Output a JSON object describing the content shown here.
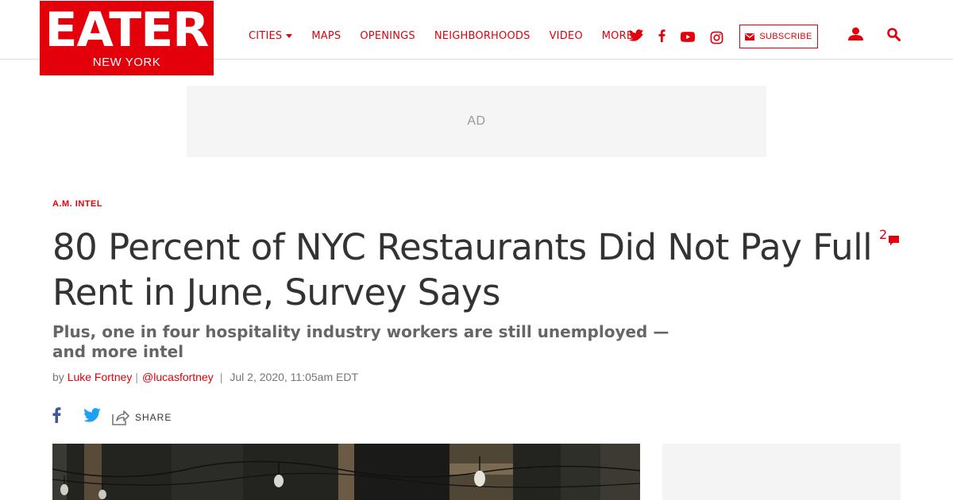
{
  "header": {
    "logo": {
      "main": "EATER",
      "sub": "NEW YORK"
    },
    "nav": [
      {
        "label": "CITIES",
        "dropdown": true
      },
      {
        "label": "MAPS",
        "dropdown": false
      },
      {
        "label": "OPENINGS",
        "dropdown": false
      },
      {
        "label": "NEIGHBORHOODS",
        "dropdown": false
      },
      {
        "label": "VIDEO",
        "dropdown": false
      },
      {
        "label": "MORE",
        "dropdown": true
      }
    ],
    "social_icons": [
      "twitter-icon",
      "facebook-icon",
      "youtube-icon",
      "instagram-icon"
    ],
    "subscribe_label": "SUBSCRIBE",
    "user_icon": "user-icon",
    "search_icon": "search-icon"
  },
  "ad": {
    "label": "AD"
  },
  "article": {
    "kicker": "A.M. INTEL",
    "headline": "80 Percent of NYC Restaurants Did Not Pay Full Rent in June, Survey Says",
    "comment_count": "2",
    "dek": "Plus, one in four hospitality industry workers are still unemployed — and more intel",
    "byline": {
      "prefix": "by",
      "author": "Luke Fortney",
      "sep": "|",
      "handle": "@lucasfortney",
      "date": "Jul 2, 2020, 11:05am EDT"
    },
    "share": {
      "icons": [
        "facebook-icon",
        "twitter-icon",
        "share-icon"
      ],
      "label": "SHARE"
    }
  },
  "colors": {
    "brand": "#e3000b",
    "text": "#333333",
    "muted": "#767676",
    "facebook": "#3b5998",
    "twitter": "#1da1f2"
  }
}
